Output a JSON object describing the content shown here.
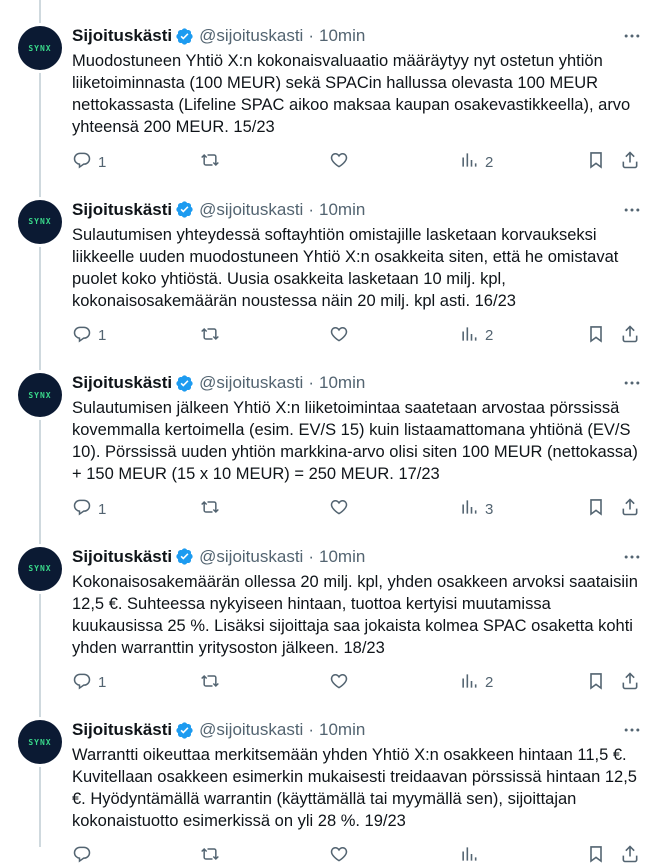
{
  "account": {
    "name": "Sijoituskästi",
    "handle": "@sijoituskasti",
    "avatar_text": "SYNX"
  },
  "icons": {
    "verified": "verified-badge-icon",
    "more": "more-dots-icon",
    "reply": "reply-icon",
    "retweet": "retweet-icon",
    "like": "heart-icon",
    "views": "views-chart-icon",
    "bookmark": "bookmark-icon",
    "share": "share-icon"
  },
  "colors": {
    "verified": "#1d9bf0",
    "thread_line": "#cfd9de",
    "secondary_text": "#536471"
  },
  "tweets": [
    {
      "time": "10min",
      "text": "Muodostuneen Yhtiö X:n kokonaisvaluaatio määräytyy nyt ostetun yhtiön liiketoiminnasta (100 MEUR) sekä SPACin hallussa olevasta 100 MEUR nettokassasta (Lifeline SPAC aikoo maksaa kaupan osakevastikkeella), arvo yhteensä 200 MEUR. 15/23",
      "replies": "1",
      "views": "2"
    },
    {
      "time": "10min",
      "text": "Sulautumisen yhteydessä softayhtiön omistajille lasketaan korvaukseksi liikkeelle uuden muodostuneen Yhtiö X:n osakkeita siten, että he omistavat puolet koko yhtiöstä. Uusia osakkeita lasketaan 10 milj. kpl, kokonaisosakemäärän noustessa näin 20 milj. kpl asti. 16/23",
      "replies": "1",
      "views": "2"
    },
    {
      "time": "10min",
      "text": "Sulautumisen jälkeen Yhtiö X:n liiketoimintaa saatetaan arvostaa pörssissä kovemmalla kertoimella (esim. EV/S 15) kuin listaamattomana yhtiönä (EV/S 10). Pörssissä uuden yhtiön markkina-arvo olisi siten 100 MEUR (nettokassa) + 150 MEUR (15 x 10 MEUR) = 250 MEUR. 17/23",
      "replies": "1",
      "views": "3"
    },
    {
      "time": "10min",
      "text": "Kokonaisosakemäärän ollessa 20 milj. kpl, yhden osakkeen arvoksi saataisiin 12,5 €. Suhteessa nykyiseen hintaan, tuottoa kertyisi muutamissa kuukausissa 25 %. Lisäksi sijoittaja saa jokaista kolmea SPAC osaketta kohti yhden warranttin yritysoston jälkeen. 18/23",
      "replies": "1",
      "views": "2"
    },
    {
      "time": "10min",
      "text": "Warrantti oikeuttaa merkitsemään yhden Yhtiö X:n osakkeen hintaan 11,5 €. Kuvitellaan osakkeen esimerkin mukaisesti treidaavan pörssissä hintaan 12,5 €. Hyödyntämällä warrantin (käyttämällä tai myymällä sen), sijoittajan kokonaistuotto esimerkissä on yli 28 %. 19/23",
      "replies": "",
      "views": ""
    }
  ]
}
